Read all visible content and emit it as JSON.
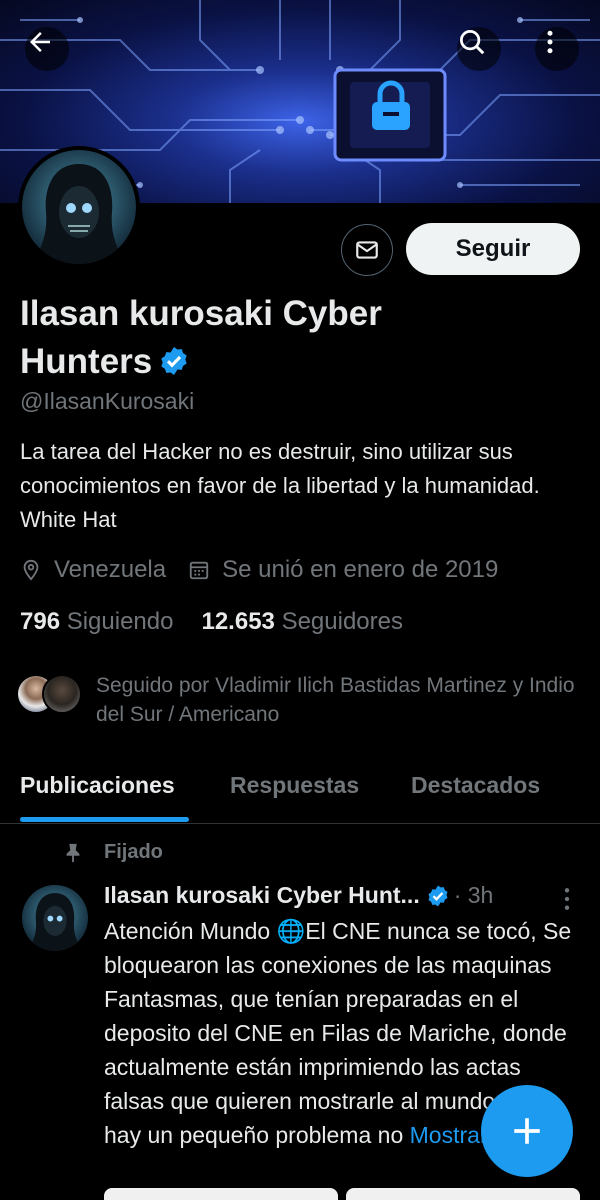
{
  "profile": {
    "name": "Ilasan kurosaki Cyber Hunters",
    "handle": "@IlasanKurosaki",
    "bio": "La tarea del Hacker no es destruir, sino utilizar sus conocimientos en favor de la libertad y la humanidad. White Hat",
    "location": "Venezuela",
    "joined": "Se unió en enero de 2019",
    "following_count": "796",
    "following_label": "Siguiendo",
    "followers_count": "12.653",
    "followers_label": "Seguidores",
    "followed_by": "Seguido por Vladimir Ilich Bastidas Martinez y Indio del Sur / Americano",
    "follow_button": "Seguir"
  },
  "tabs": [
    {
      "label": "Publicaciones",
      "active": true
    },
    {
      "label": "Respuestas",
      "active": false
    },
    {
      "label": "Destacados",
      "active": false
    }
  ],
  "post": {
    "pinned_label": "Fijado",
    "author": "Ilasan kurosaki Cyber Hunt...",
    "time": "· 3h",
    "text": "Atención Mundo 🌐El CNE nunca se tocó, Se bloquearon las conexiones de las maquinas Fantasmas, que tenían preparadas en el deposito del CNE en Filas de Mariche, donde actualmente están imprimiendo las actas falsas que quieren mostrarle al mundo, pero hay un pequeño problema no ",
    "show_more": "Mostrar más"
  },
  "colors": {
    "accent": "#1d9bf0",
    "background": "#000000",
    "secondary_text": "#71767b"
  },
  "icons": [
    "back-arrow-icon",
    "search-icon",
    "more-vertical-icon",
    "mail-icon",
    "verified-badge-icon",
    "location-pin-icon",
    "calendar-icon",
    "pin-icon",
    "plus-icon"
  ]
}
